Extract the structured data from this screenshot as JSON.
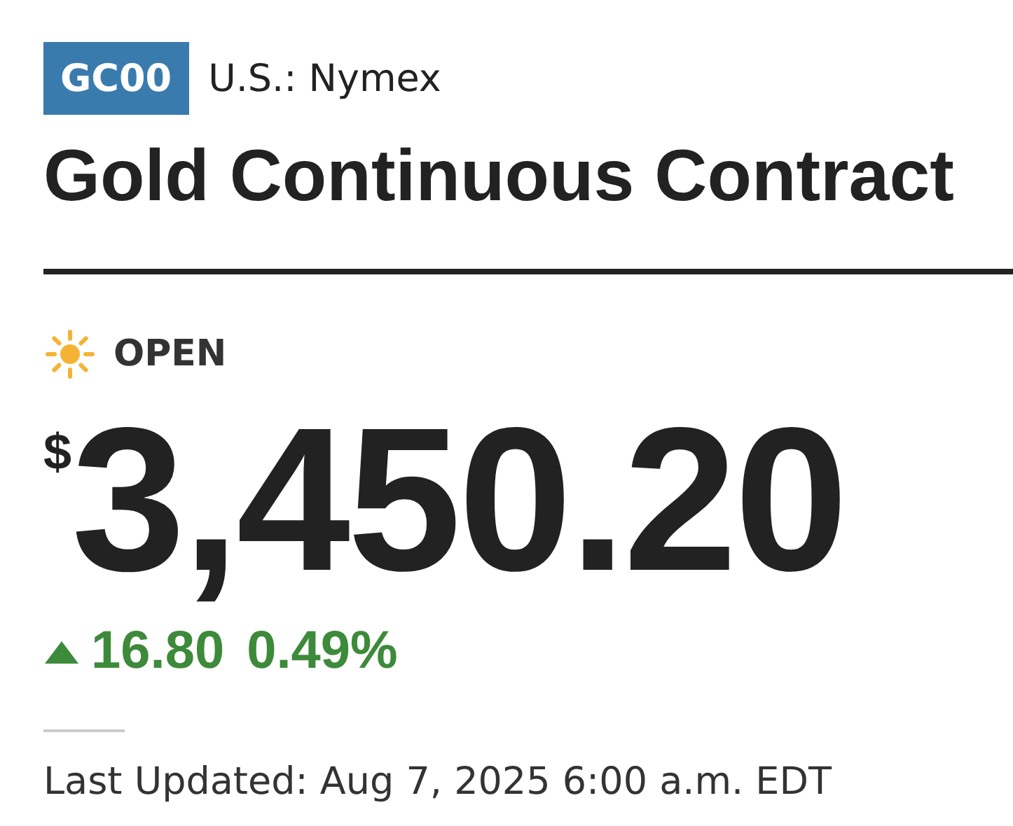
{
  "ticker": {
    "symbol": "GC00",
    "exchange": "U.S.: Nymex"
  },
  "title": "Gold Continuous Contract",
  "market_status": {
    "kind": "open",
    "label": "OPEN"
  },
  "price": {
    "currency": "$",
    "value": "3,450.20"
  },
  "change": {
    "rising": true,
    "amount": "16.80",
    "percent": "0.49%"
  },
  "last_updated": "Last Updated: Aug 7, 2025 6:00 a.m. EDT"
}
